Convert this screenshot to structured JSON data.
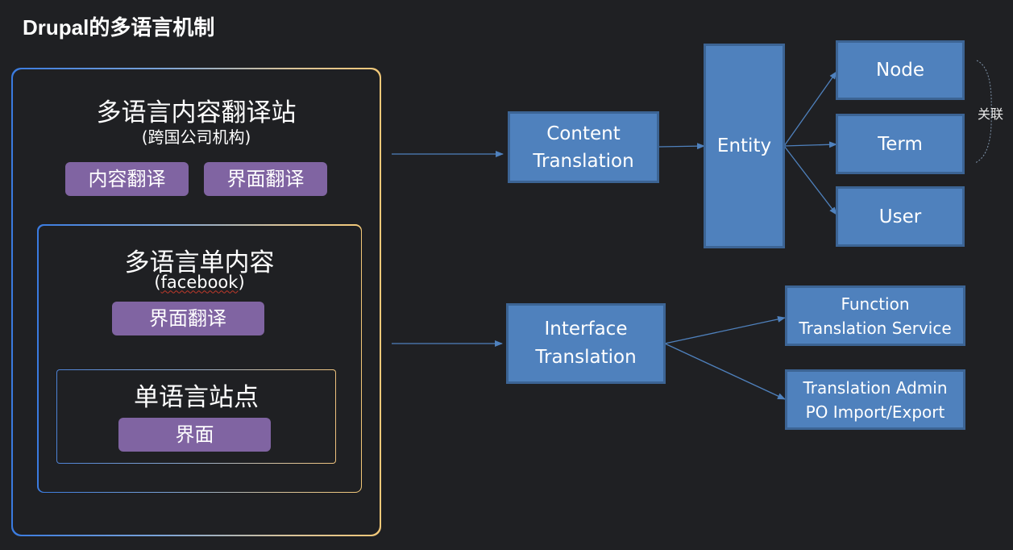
{
  "title": "Drupal的多语言机制",
  "left_panel": {
    "outer": {
      "title": "多语言内容翻译站",
      "subtitle": "(跨国公司机构)",
      "tags": [
        "内容翻译",
        "界面翻译"
      ]
    },
    "middle": {
      "title": "多语言单内容",
      "subtitle_open": "(",
      "subtitle_word": "facebook",
      "subtitle_close": ")",
      "tags": [
        "界面翻译"
      ]
    },
    "inner": {
      "title": "单语言站点",
      "tags": [
        "界面"
      ]
    }
  },
  "flow": {
    "content_translation": [
      "Content",
      "Translation"
    ],
    "entity": "Entity",
    "entity_targets": [
      "Node",
      "Term",
      "User"
    ],
    "association_label": "关联",
    "interface_translation": [
      "Interface",
      "Translation"
    ],
    "interface_targets": [
      [
        "Function",
        "Translation Service"
      ],
      [
        "Translation Admin",
        "PO Import/Export"
      ]
    ]
  },
  "colors": {
    "background": "#1f2023",
    "box_fill": "#4f81bd",
    "box_border": "#3c6494",
    "tag_fill": "#8064a2",
    "arrow": "#4f81bd"
  }
}
